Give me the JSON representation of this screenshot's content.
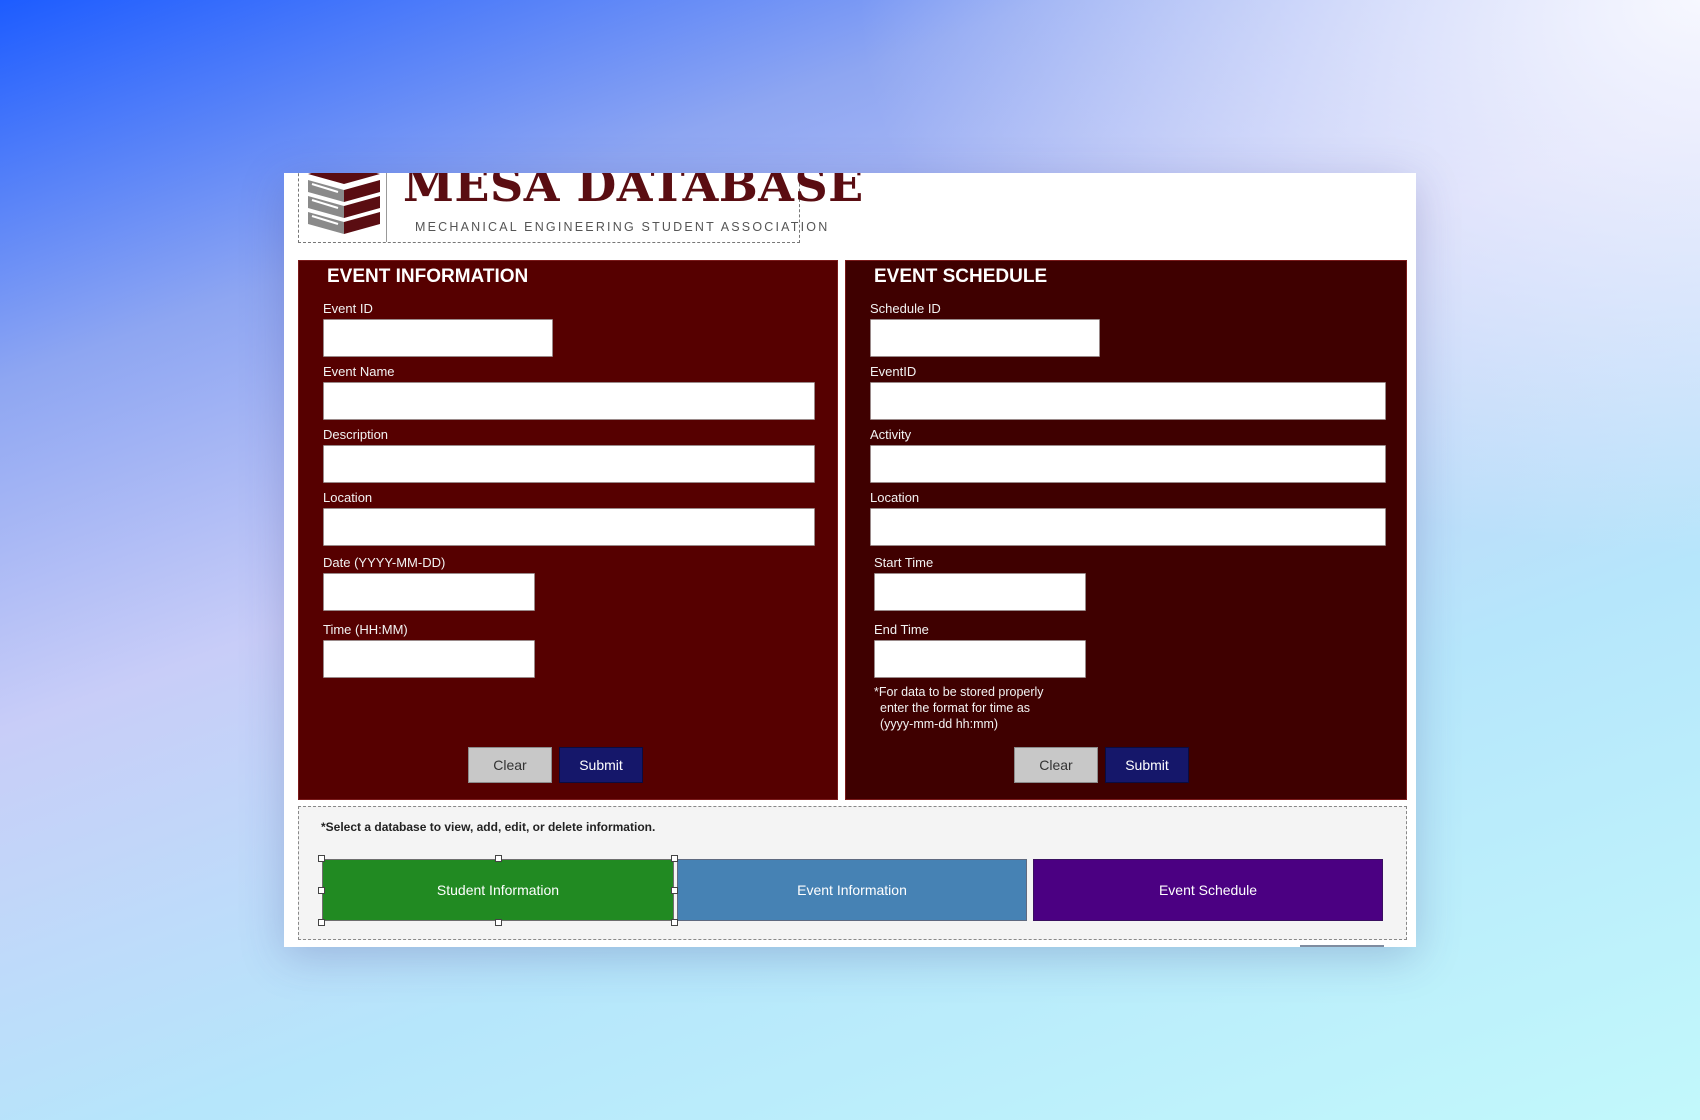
{
  "header": {
    "title": "MESA DATABASE",
    "subtitle": "MECHANICAL ENGINEERING STUDENT ASSOCIATION"
  },
  "event_information": {
    "title": "EVENT INFORMATION",
    "fields": [
      {
        "label": "Event ID",
        "value": ""
      },
      {
        "label": "Event Name",
        "value": ""
      },
      {
        "label": "Description",
        "value": ""
      },
      {
        "label": "Location",
        "value": ""
      },
      {
        "label": "Date (YYYY-MM-DD)",
        "value": ""
      },
      {
        "label": "Time (HH:MM)",
        "value": ""
      }
    ],
    "clear_label": "Clear",
    "submit_label": "Submit"
  },
  "event_schedule": {
    "title": "EVENT SCHEDULE",
    "fields": [
      {
        "label": "Schedule ID",
        "value": ""
      },
      {
        "label": "EventID",
        "value": ""
      },
      {
        "label": "Activity",
        "value": ""
      },
      {
        "label": "Location",
        "value": ""
      },
      {
        "label": "Start Time",
        "value": ""
      },
      {
        "label": "End Time",
        "value": ""
      }
    ],
    "note": [
      "*For data to be stored properly",
      "enter the format for time as",
      "(yyyy-mm-dd hh:mm)"
    ],
    "clear_label": "Clear",
    "submit_label": "Submit"
  },
  "navigation": {
    "hint": "*Select a database to view, add, edit, or delete information.",
    "buttons": [
      {
        "label": "Student Information",
        "color": "#218a22",
        "selected": true
      },
      {
        "label": "Event Information",
        "color": "#4682b4",
        "selected": false
      },
      {
        "label": "Event Schedule",
        "color": "#4b0082",
        "selected": false
      }
    ]
  },
  "colors": {
    "event_information_panel": "#560000",
    "event_schedule_panel": "#3f0000",
    "submit_button": "#15176a",
    "clear_button": "#c8c8c8",
    "logo_title": "#5a0d12"
  },
  "icons": [
    "database-stack-icon"
  ]
}
